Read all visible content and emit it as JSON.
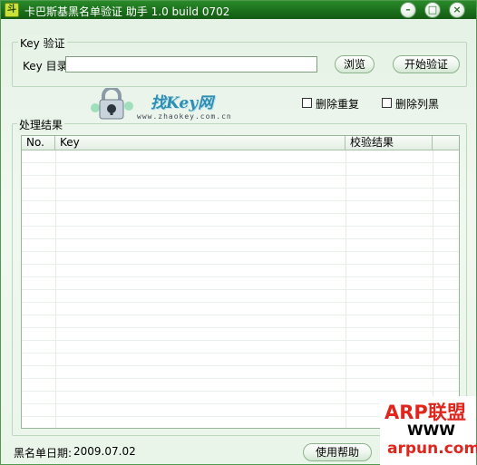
{
  "window": {
    "title": "卡巴斯基黑名单验证 助手 1.0 build 0702",
    "app_icon": "app-icon",
    "controls": {
      "minimize": "minimize-icon",
      "maximize": "maximize-icon",
      "close": "close-icon"
    },
    "accent_color": "#1b6f1b"
  },
  "key_section": {
    "group_label": "Key 验证",
    "dir_label": "Key 目录",
    "dir_value": "",
    "browse_label": "浏览",
    "start_label": "开始验证"
  },
  "logo": {
    "brand": "找Key网",
    "url": "www.zhaokey.com.cn",
    "icon": "lock-icon"
  },
  "options": {
    "remove_duplicates_label": "删除重复",
    "remove_blacklisted_label": "删除列黑"
  },
  "results": {
    "group_label": "处理结果",
    "columns": [
      "No.",
      "Key",
      "校验结果"
    ],
    "rows": []
  },
  "status": {
    "blacklist_date_label": "黑名单日期:",
    "blacklist_date_value": "2009.07.02",
    "help_label": "使用帮助"
  },
  "watermark": {
    "line1": "ARP联盟",
    "line2": "WWW",
    "line3": "arpun.com"
  }
}
